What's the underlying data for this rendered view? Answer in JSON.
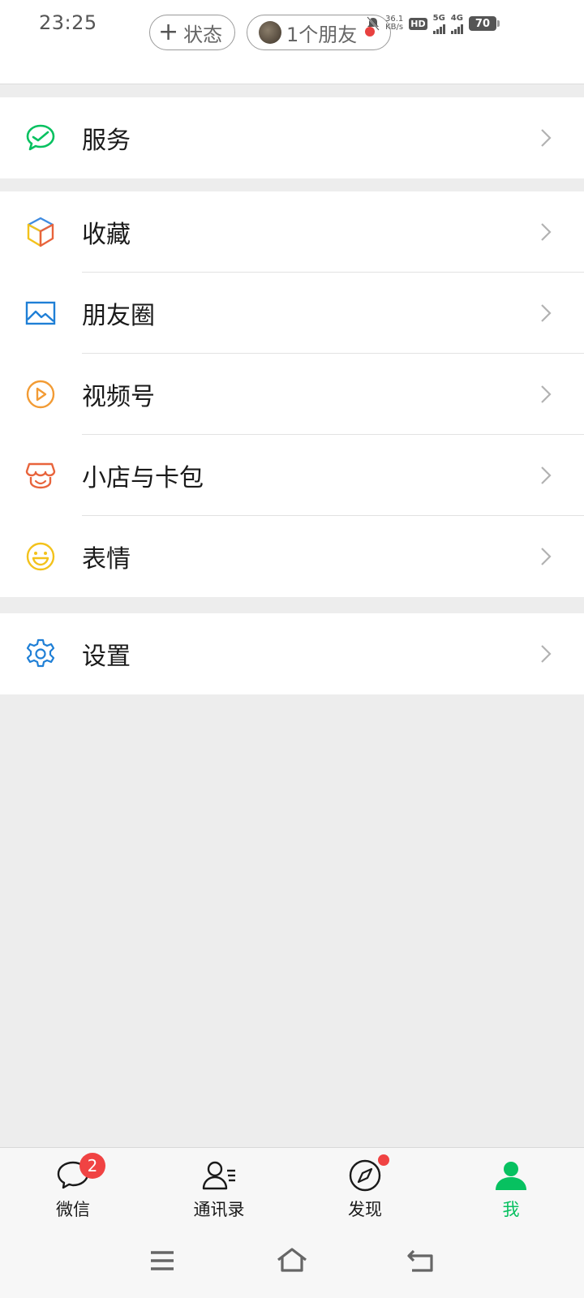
{
  "status_bar": {
    "time": "23:25",
    "net_speed_value": "36.1",
    "net_speed_unit": "KB/s",
    "hd_label": "HD",
    "sim1": "5G",
    "sim2": "4G",
    "battery": "70"
  },
  "header": {
    "status_button_label": "状态",
    "friends_pill_label": "1个朋友"
  },
  "menu_groups": [
    {
      "items": [
        {
          "label": "服务",
          "icon": "service-icon",
          "color": "#07c160"
        }
      ]
    },
    {
      "items": [
        {
          "label": "收藏",
          "icon": "favorites-cube-icon",
          "color": "#3f8be0"
        },
        {
          "label": "朋友圈",
          "icon": "moments-picture-icon",
          "color": "#1f7fd6"
        },
        {
          "label": "视频号",
          "icon": "channels-play-icon",
          "color": "#f29b34"
        },
        {
          "label": "小店与卡包",
          "icon": "shop-icon",
          "color": "#e8643c"
        },
        {
          "label": "表情",
          "icon": "sticker-smile-icon",
          "color": "#f3c21b"
        }
      ]
    },
    {
      "items": [
        {
          "label": "设置",
          "icon": "gear-icon",
          "color": "#1f7fd6"
        }
      ]
    }
  ],
  "tabbar": {
    "tabs": [
      {
        "label": "微信",
        "icon": "chat-bubble-icon",
        "badge": "2"
      },
      {
        "label": "通讯录",
        "icon": "contacts-icon"
      },
      {
        "label": "发现",
        "icon": "compass-icon",
        "dot": true
      },
      {
        "label": "我",
        "icon": "person-icon",
        "active": true
      }
    ],
    "active_color": "#07c160"
  },
  "nav_bar": {
    "buttons": [
      "menu-icon",
      "home-icon",
      "back-icon"
    ]
  }
}
